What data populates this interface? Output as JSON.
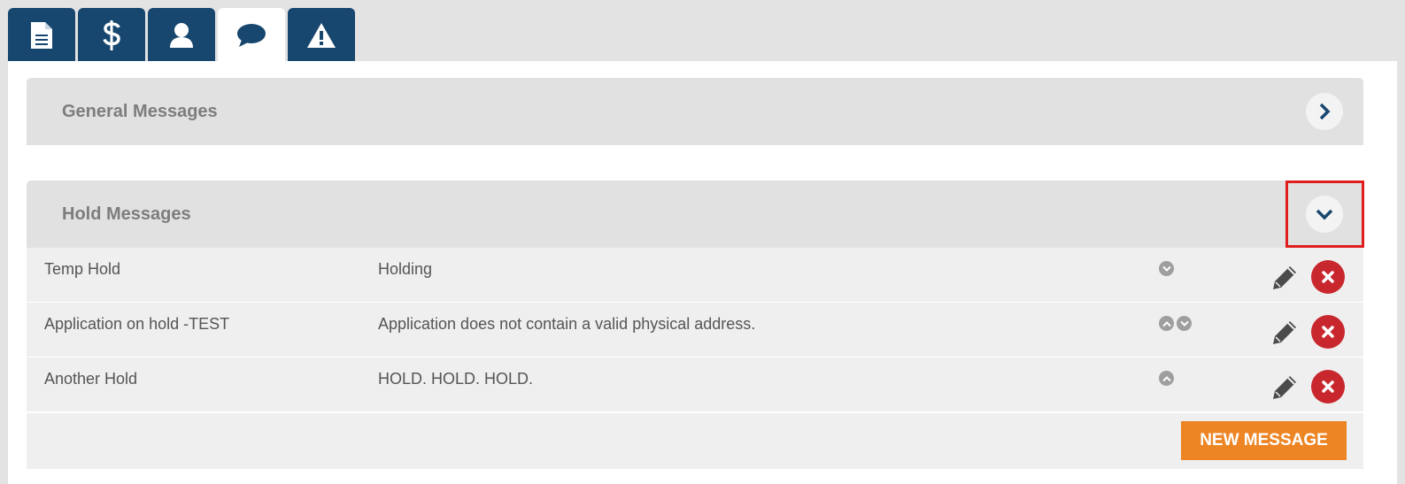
{
  "tabs": [
    {
      "icon": "document-icon",
      "active": false
    },
    {
      "icon": "dollar-icon",
      "active": false
    },
    {
      "icon": "user-icon",
      "active": false
    },
    {
      "icon": "chat-bubble-icon",
      "active": true
    },
    {
      "icon": "warning-icon",
      "active": false
    }
  ],
  "general_section": {
    "title": "General Messages",
    "toggle_icon": "chevron-right-icon"
  },
  "hold_section": {
    "title": "Hold Messages",
    "toggle_icon": "chevron-down-icon",
    "messages": [
      {
        "name": "Temp Hold",
        "text": "Holding",
        "order_controls": [
          "down"
        ]
      },
      {
        "name": "Application on hold -TEST",
        "text": "Application does not contain a valid physical address.",
        "order_controls": [
          "up",
          "down"
        ]
      },
      {
        "name": "Another Hold",
        "text": "HOLD. HOLD. HOLD.",
        "order_controls": [
          "up"
        ]
      }
    ],
    "new_button_label": "NEW MESSAGE"
  },
  "colors": {
    "tab_bg": "#17466e",
    "header_bg": "#e1e1e1",
    "row_bg": "#efefef",
    "delete_red": "#c8272d",
    "new_button_orange": "#ee8524",
    "focus_outline": "#e01e1e"
  }
}
